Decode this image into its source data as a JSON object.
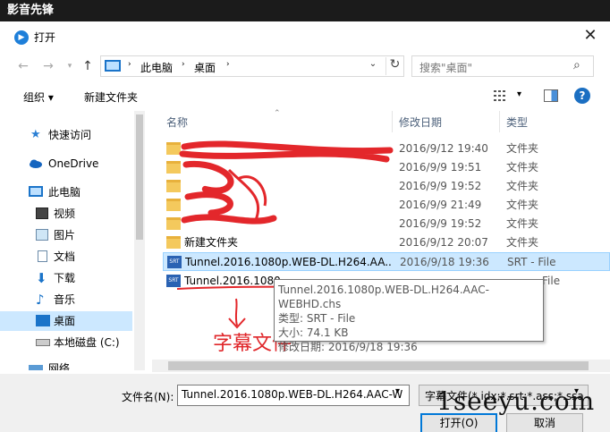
{
  "app": {
    "title": "影音先锋"
  },
  "dialog": {
    "title": "打开",
    "icon": "play-circle-icon"
  },
  "nav": {
    "back_icon": "arrow-left-icon",
    "forward_icon": "arrow-right-icon",
    "recent_icon": "chevron-down-icon",
    "up_icon": "arrow-up-icon",
    "breadcrumbs": [
      "此电脑",
      "桌面"
    ],
    "refresh_icon": "refresh-icon",
    "search_placeholder": "搜索\"桌面\""
  },
  "toolbar": {
    "organize": "组织 ▾",
    "new_folder": "新建文件夹"
  },
  "sidebar": {
    "items": [
      {
        "label": "快速访问",
        "icon": "star-icon"
      },
      {
        "label": "OneDrive",
        "icon": "cloud-icon"
      },
      {
        "label": "此电脑",
        "icon": "computer-icon"
      },
      {
        "label": "视频",
        "icon": "video-folder-icon"
      },
      {
        "label": "图片",
        "icon": "pictures-folder-icon"
      },
      {
        "label": "文档",
        "icon": "documents-folder-icon"
      },
      {
        "label": "下载",
        "icon": "download-icon"
      },
      {
        "label": "音乐",
        "icon": "music-icon"
      },
      {
        "label": "桌面",
        "icon": "desktop-icon"
      },
      {
        "label": "本地磁盘 (C:)",
        "icon": "drive-icon"
      },
      {
        "label": "网络",
        "icon": "network-icon"
      }
    ]
  },
  "columns": {
    "name": "名称",
    "date": "修改日期",
    "type": "类型"
  },
  "files": [
    {
      "name": "",
      "date": "2016/9/12 19:40",
      "type": "文件夹"
    },
    {
      "name": "",
      "date": "2016/9/9 19:51",
      "type": "文件夹"
    },
    {
      "name": "",
      "date": "2016/9/9 19:52",
      "type": "文件夹"
    },
    {
      "name": "",
      "date": "2016/9/9 21:49",
      "type": "文件夹"
    },
    {
      "name": "",
      "date": "2016/9/9 19:52",
      "type": "文件夹"
    },
    {
      "name": "新建文件夹",
      "date": "2016/9/12 20:07",
      "type": "文件夹"
    },
    {
      "name": "Tunnel.2016.1080p.WEB-DL.H264.AA...",
      "date": "2016/9/18 19:36",
      "type": "SRT - File"
    },
    {
      "name": "Tunnel.2016.1080",
      "date": "",
      "type": "File"
    }
  ],
  "tooltip": {
    "filename": "Tunnel.2016.1080p.WEB-DL.H264.AAC-WEBHD.chs",
    "type": "类型: SRT - File",
    "size": "大小: 74.1 KB",
    "modified": "修改日期: 2016/9/18 19:36"
  },
  "annotation": {
    "text": "字幕文件"
  },
  "bottom": {
    "filename_label": "文件名(N):",
    "filename_value": "Tunnel.2016.1080p.WEB-DL.H264.AAC-W",
    "filetype_value": "字幕文件(*.idx;*.srt;*.ass;*.ssa",
    "open_label": "打开(O)",
    "cancel_label": "取消"
  },
  "watermark": "1seeyu.com",
  "colors": {
    "accent": "#0078d7",
    "selection": "#cce8ff",
    "annotation": "#e0262a"
  }
}
